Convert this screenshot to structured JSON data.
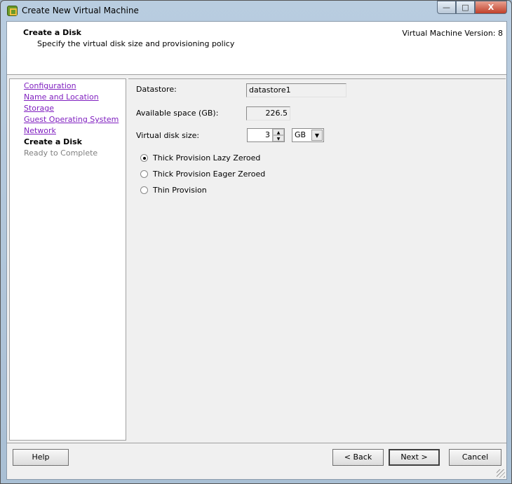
{
  "window": {
    "title": "Create New Virtual Machine",
    "controls": [
      "minimize",
      "maximize",
      "close"
    ]
  },
  "header": {
    "title": "Create a Disk",
    "subtitle": "Specify the virtual disk size and provisioning policy",
    "version": "Virtual Machine Version: 8"
  },
  "nav": {
    "items": [
      {
        "label": "Configuration",
        "state": "link"
      },
      {
        "label": "Name and Location",
        "state": "link"
      },
      {
        "label": "Storage",
        "state": "link"
      },
      {
        "label": "Guest Operating System",
        "state": "link"
      },
      {
        "label": "Network",
        "state": "link"
      },
      {
        "label": "Create a Disk",
        "state": "current"
      },
      {
        "label": "Ready to Complete",
        "state": "disabled"
      }
    ]
  },
  "form": {
    "datastore_label": "Datastore:",
    "datastore_value": "datastore1",
    "available_label": "Available space (GB):",
    "available_value": "226.5",
    "size_label": "Virtual disk size:",
    "size_value": "3",
    "size_unit": "GB",
    "provisioning": [
      {
        "label": "Thick Provision Lazy Zeroed",
        "selected": true
      },
      {
        "label": "Thick Provision Eager Zeroed",
        "selected": false
      },
      {
        "label": "Thin Provision",
        "selected": false
      }
    ]
  },
  "buttons": {
    "help": "Help",
    "back": "< Back",
    "next": "Next >",
    "cancel": "Cancel"
  }
}
